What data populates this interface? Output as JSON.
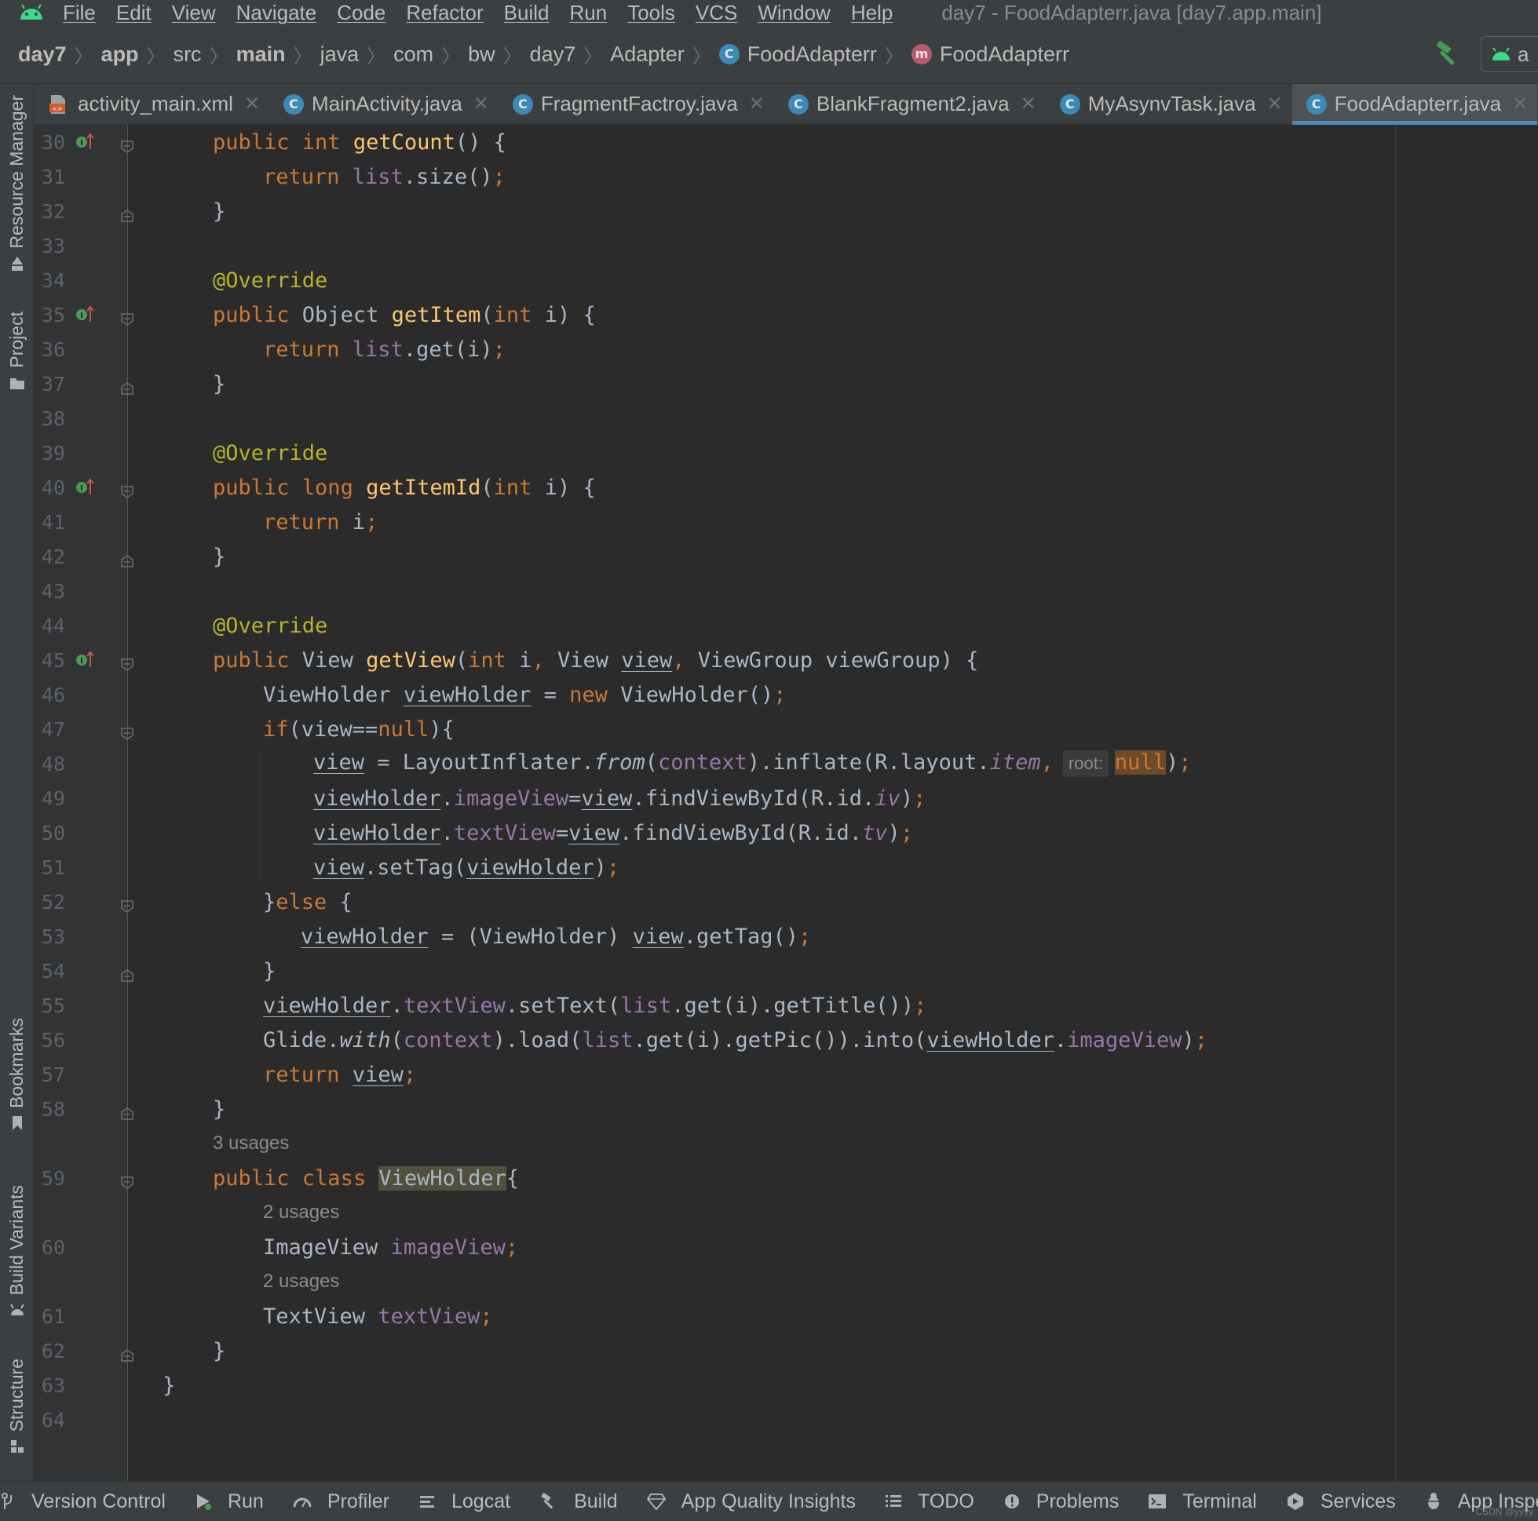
{
  "menubar": {
    "items": [
      "File",
      "Edit",
      "View",
      "Navigate",
      "Code",
      "Refactor",
      "Build",
      "Run",
      "Tools",
      "VCS",
      "Window",
      "Help"
    ],
    "window_title": "day7 - FoodAdapterr.java [day7.app.main]"
  },
  "breadcrumbs": {
    "items": [
      {
        "label": "day7",
        "bold": true
      },
      {
        "label": "app",
        "bold": true
      },
      {
        "label": "src"
      },
      {
        "label": "main",
        "bold": true
      },
      {
        "label": "java"
      },
      {
        "label": "com"
      },
      {
        "label": "bw"
      },
      {
        "label": "day7"
      },
      {
        "label": "Adapter"
      },
      {
        "label": "FoodAdapterr",
        "icon": "class-icon"
      },
      {
        "label": "FoodAdapterr",
        "icon": "method-icon"
      }
    ],
    "device_label": "a"
  },
  "tabs": [
    {
      "label": "activity_main.xml",
      "icon": "xml-file-icon",
      "active": false
    },
    {
      "label": "MainActivity.java",
      "icon": "class-icon",
      "active": false
    },
    {
      "label": "FragmentFactroy.java",
      "icon": "class-icon",
      "active": false
    },
    {
      "label": "BlankFragment2.java",
      "icon": "class-icon",
      "active": false
    },
    {
      "label": "MyAsynvTask.java",
      "icon": "class-icon",
      "active": false
    },
    {
      "label": "FoodAdapterr.java",
      "icon": "class-icon",
      "active": true
    }
  ],
  "left_tools": [
    "Resource Manager",
    "Project",
    "Bookmarks",
    "Build Variants",
    "Structure"
  ],
  "colors": {
    "keyword": "#cc7832",
    "function": "#ffc66d",
    "annotation": "#bbb529",
    "field": "#9876aa",
    "text": "#a9b7c6",
    "line_number": "#606366",
    "accent": "#4a88c7"
  },
  "code_rows": [
    {
      "n": "30",
      "override": true,
      "fold": "open",
      "ind": 2,
      "tokens": [
        [
          "public ",
          "kw"
        ],
        [
          "int ",
          "kw"
        ],
        [
          "getCount",
          "fn"
        ],
        [
          "() {",
          ""
        ]
      ]
    },
    {
      "n": "31",
      "ind": 3,
      "tokens": [
        [
          "return ",
          "kw"
        ],
        [
          "list",
          "fld"
        ],
        [
          ".size()",
          ""
        ],
        [
          ";",
          "kw"
        ]
      ]
    },
    {
      "n": "32",
      "fold": "close",
      "ind": 2,
      "tokens": [
        [
          "}",
          ""
        ]
      ]
    },
    {
      "n": "33",
      "ind": 0,
      "tokens": []
    },
    {
      "n": "34",
      "ind": 2,
      "tokens": [
        [
          "@Override",
          "an"
        ]
      ]
    },
    {
      "n": "35",
      "override": true,
      "fold": "open",
      "ind": 2,
      "tokens": [
        [
          "public ",
          "kw"
        ],
        [
          "Object ",
          ""
        ],
        [
          "getItem",
          "fn"
        ],
        [
          "(",
          ""
        ],
        [
          "int ",
          "kw"
        ],
        [
          "i) {",
          ""
        ]
      ]
    },
    {
      "n": "36",
      "ind": 3,
      "tokens": [
        [
          "return ",
          "kw"
        ],
        [
          "list",
          "fld"
        ],
        [
          ".get(i)",
          ""
        ],
        [
          ";",
          "kw"
        ]
      ]
    },
    {
      "n": "37",
      "fold": "close",
      "ind": 2,
      "tokens": [
        [
          "}",
          ""
        ]
      ]
    },
    {
      "n": "38",
      "ind": 0,
      "tokens": []
    },
    {
      "n": "39",
      "ind": 2,
      "tokens": [
        [
          "@Override",
          "an"
        ]
      ]
    },
    {
      "n": "40",
      "override": true,
      "fold": "open",
      "ind": 2,
      "tokens": [
        [
          "public ",
          "kw"
        ],
        [
          "long ",
          "kw"
        ],
        [
          "getItemId",
          "fn"
        ],
        [
          "(",
          ""
        ],
        [
          "int ",
          "kw"
        ],
        [
          "i) {",
          ""
        ]
      ]
    },
    {
      "n": "41",
      "ind": 3,
      "tokens": [
        [
          "return ",
          "kw"
        ],
        [
          "i",
          ""
        ],
        [
          ";",
          "kw"
        ]
      ]
    },
    {
      "n": "42",
      "fold": "close",
      "ind": 2,
      "tokens": [
        [
          "}",
          ""
        ]
      ]
    },
    {
      "n": "43",
      "ind": 0,
      "tokens": []
    },
    {
      "n": "44",
      "ind": 2,
      "tokens": [
        [
          "@Override",
          "an"
        ]
      ]
    },
    {
      "n": "45",
      "override": true,
      "fold": "open",
      "ind": 2,
      "tokens": [
        [
          "public ",
          "kw"
        ],
        [
          "View ",
          ""
        ],
        [
          "getView",
          "fn"
        ],
        [
          "(",
          ""
        ],
        [
          "int ",
          "kw"
        ],
        [
          "i",
          ""
        ],
        [
          ", ",
          "kw"
        ],
        [
          "View ",
          ""
        ],
        [
          "view",
          "var"
        ],
        [
          ", ",
          "kw"
        ],
        [
          "ViewGroup viewGroup) {",
          ""
        ]
      ]
    },
    {
      "n": "46",
      "ind": 3,
      "tokens": [
        [
          "ViewHolder ",
          ""
        ],
        [
          "viewHolder",
          "var"
        ],
        [
          " = ",
          ""
        ],
        [
          "new ",
          "kw"
        ],
        [
          "ViewHolder()",
          ""
        ],
        [
          ";",
          "kw"
        ]
      ]
    },
    {
      "n": "47",
      "fold": "open",
      "ind": 3,
      "tokens": [
        [
          "if",
          "kw"
        ],
        [
          "(view==",
          ""
        ],
        [
          "null",
          "kw"
        ],
        [
          "){",
          ""
        ]
      ]
    },
    {
      "n": "48",
      "ind": 4,
      "tokens": [
        [
          "view",
          "var"
        ],
        [
          " = LayoutInflater.",
          ""
        ],
        [
          "from",
          "it"
        ],
        [
          "(",
          ""
        ],
        [
          "context",
          "fld"
        ],
        [
          ").inflate(R.layout.",
          ""
        ],
        [
          "item",
          "fld-it"
        ],
        [
          ",",
          "kw"
        ],
        [
          "root:",
          "inlay"
        ],
        [
          "null",
          "nullhl"
        ],
        [
          ")",
          ""
        ],
        [
          ";",
          "kw"
        ]
      ]
    },
    {
      "n": "49",
      "ind": 4,
      "tokens": [
        [
          "viewHolder",
          "var"
        ],
        [
          ".",
          ""
        ],
        [
          "imageView",
          "fld"
        ],
        [
          "=",
          ""
        ],
        [
          "view",
          "var"
        ],
        [
          ".findViewById(R.id.",
          ""
        ],
        [
          "iv",
          "fld-it"
        ],
        [
          ")",
          ""
        ],
        [
          ";",
          "kw"
        ]
      ]
    },
    {
      "n": "50",
      "ind": 4,
      "tokens": [
        [
          "viewHolder",
          "var"
        ],
        [
          ".",
          ""
        ],
        [
          "textView",
          "fld"
        ],
        [
          "=",
          ""
        ],
        [
          "view",
          "var"
        ],
        [
          ".findViewById(R.id.",
          ""
        ],
        [
          "tv",
          "fld-it"
        ],
        [
          ")",
          ""
        ],
        [
          ";",
          "kw"
        ]
      ]
    },
    {
      "n": "51",
      "ind": 4,
      "tokens": [
        [
          "view",
          "var"
        ],
        [
          ".setTag(",
          ""
        ],
        [
          "viewHolder",
          "var"
        ],
        [
          ")",
          ""
        ],
        [
          ";",
          "kw"
        ]
      ]
    },
    {
      "n": "52",
      "fold": "open",
      "ind": 3,
      "tokens": [
        [
          "}",
          ""
        ],
        [
          "else ",
          "kw"
        ],
        [
          "{",
          ""
        ]
      ]
    },
    {
      "n": "53",
      "ind": 3.75,
      "tokens": [
        [
          "viewHolder",
          "var"
        ],
        [
          " = (ViewHolder) ",
          ""
        ],
        [
          "view",
          "var"
        ],
        [
          ".getTag()",
          ""
        ],
        [
          ";",
          "kw"
        ]
      ]
    },
    {
      "n": "54",
      "fold": "close",
      "ind": 3,
      "tokens": [
        [
          "}",
          ""
        ]
      ]
    },
    {
      "n": "55",
      "ind": 3,
      "tokens": [
        [
          "viewHolder",
          "var"
        ],
        [
          ".",
          ""
        ],
        [
          "textView",
          "fld"
        ],
        [
          ".setText(",
          ""
        ],
        [
          "list",
          "fld"
        ],
        [
          ".get(i).getTitle())",
          ""
        ],
        [
          ";",
          "kw"
        ]
      ]
    },
    {
      "n": "56",
      "ind": 3,
      "tokens": [
        [
          "Glide.",
          ""
        ],
        [
          "with",
          "it"
        ],
        [
          "(",
          ""
        ],
        [
          "context",
          "fld"
        ],
        [
          ").load(",
          ""
        ],
        [
          "list",
          "fld"
        ],
        [
          ".get(i).getPic()).into(",
          ""
        ],
        [
          "viewHolder",
          "var"
        ],
        [
          ".",
          ""
        ],
        [
          "imageView",
          "fld"
        ],
        [
          ")",
          ""
        ],
        [
          ";",
          "kw"
        ]
      ]
    },
    {
      "n": "57",
      "ind": 3,
      "tokens": [
        [
          "return ",
          "kw"
        ],
        [
          "view",
          "var"
        ],
        [
          ";",
          "kw"
        ]
      ]
    },
    {
      "n": "58",
      "fold": "close",
      "ind": 2,
      "tokens": [
        [
          "}",
          ""
        ]
      ]
    },
    {
      "hint": "3 usages",
      "ind": 2
    },
    {
      "n": "59",
      "fold": "open",
      "ind": 2,
      "tokens": [
        [
          "public ",
          "kw"
        ],
        [
          "class ",
          "kw"
        ],
        [
          "ViewHolder",
          "hl"
        ],
        [
          "{",
          ""
        ]
      ]
    },
    {
      "hint": "2 usages",
      "ind": 3
    },
    {
      "n": "60",
      "ind": 3,
      "tokens": [
        [
          "ImageView ",
          ""
        ],
        [
          "imageView",
          "fld"
        ],
        [
          ";",
          "kw"
        ]
      ]
    },
    {
      "hint": "2 usages",
      "ind": 3
    },
    {
      "n": "61",
      "ind": 3,
      "tokens": [
        [
          "TextView ",
          ""
        ],
        [
          "textView",
          "fld"
        ],
        [
          ";",
          "kw"
        ]
      ]
    },
    {
      "n": "62",
      "fold": "close",
      "ind": 2,
      "tokens": [
        [
          "}",
          ""
        ]
      ]
    },
    {
      "n": "63",
      "ind": 1,
      "tokens": [
        [
          "}",
          ""
        ]
      ]
    },
    {
      "n": "64",
      "ind": 0,
      "tokens": []
    }
  ],
  "bottom_tools": [
    {
      "label": "Version Control",
      "icon": "vcs-branch-icon"
    },
    {
      "label": "Run",
      "icon": "run-icon"
    },
    {
      "label": "Profiler",
      "icon": "profiler-icon"
    },
    {
      "label": "Logcat",
      "icon": "logcat-icon"
    },
    {
      "label": "Build",
      "icon": "build-hammer-icon"
    },
    {
      "label": "App Quality Insights",
      "icon": "diamond-icon"
    },
    {
      "label": "TODO",
      "icon": "todo-list-icon"
    },
    {
      "label": "Problems",
      "icon": "problems-icon"
    },
    {
      "label": "Terminal",
      "icon": "terminal-icon"
    },
    {
      "label": "Services",
      "icon": "services-icon"
    },
    {
      "label": "App Inspecti",
      "icon": "app-inspection-icon"
    }
  ],
  "watermark": "CSDN @yyyy"
}
